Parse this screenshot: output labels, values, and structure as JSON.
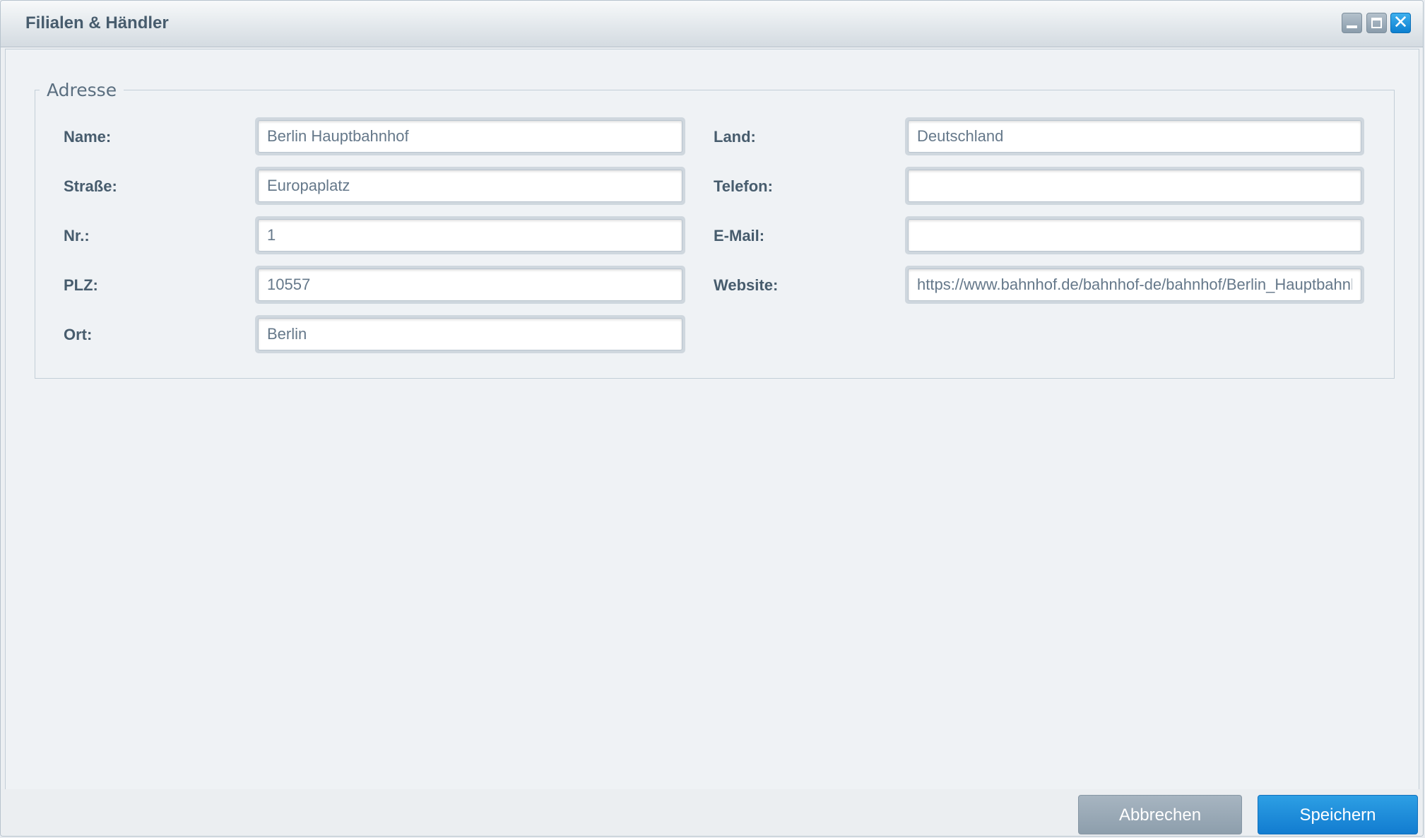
{
  "window": {
    "title": "Filialen & Händler"
  },
  "fieldset": {
    "legend": "Adresse"
  },
  "form": {
    "name": {
      "label": "Name:",
      "value": "Berlin Hauptbahnhof"
    },
    "strasse": {
      "label": "Straße:",
      "value": "Europaplatz"
    },
    "nr": {
      "label": "Nr.:",
      "value": "1"
    },
    "plz": {
      "label": "PLZ:",
      "value": "10557"
    },
    "ort": {
      "label": "Ort:",
      "value": "Berlin"
    },
    "land": {
      "label": "Land:",
      "value": "Deutschland"
    },
    "telefon": {
      "label": "Telefon:",
      "value": ""
    },
    "email": {
      "label": "E-Mail:",
      "value": ""
    },
    "website": {
      "label": "Website:",
      "value": "https://www.bahnhof.de/bahnhof-de/bahnhof/Berlin_Hauptbahnhof"
    }
  },
  "buttons": {
    "cancel": "Abbrechen",
    "save": "Speichern"
  },
  "colors": {
    "accent": "#1a88d8",
    "title_text": "#475c6d"
  },
  "icons": {
    "minimize": "minimize-icon",
    "maximize": "maximize-icon",
    "close": "close-icon"
  }
}
